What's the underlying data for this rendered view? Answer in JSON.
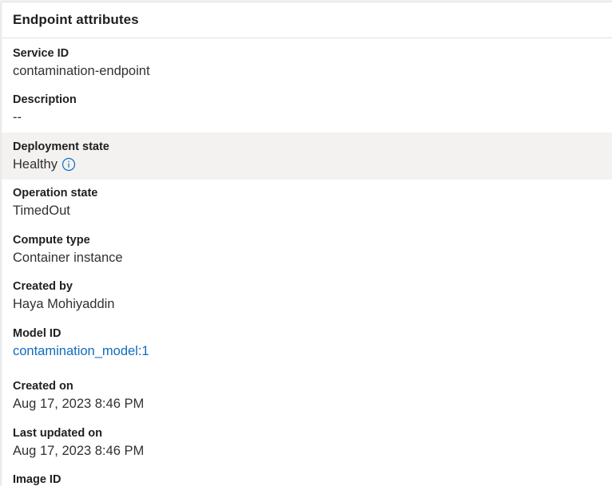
{
  "panel": {
    "title": "Endpoint attributes"
  },
  "attributes": [
    {
      "label": "Service ID",
      "value": "contamination-endpoint"
    },
    {
      "label": "Description",
      "value": "--"
    },
    {
      "label": "Deployment state",
      "value": "Healthy",
      "icon": "info-icon"
    },
    {
      "label": "Operation state",
      "value": "TimedOut"
    },
    {
      "label": "Compute type",
      "value": "Container instance"
    },
    {
      "label": "Created by",
      "value": "Haya Mohiyaddin"
    },
    {
      "label": "Model ID",
      "value": "contamination_model:1",
      "link": true
    },
    {
      "label": "Created on",
      "value": "Aug 17, 2023 8:46 PM"
    },
    {
      "label": "Last updated on",
      "value": "Aug 17, 2023 8:46 PM"
    },
    {
      "label": "Image ID",
      "value": ""
    }
  ],
  "colors": {
    "link": "#0f6cbd",
    "highlight_row": "#f3f2f1",
    "text": "#323130"
  }
}
